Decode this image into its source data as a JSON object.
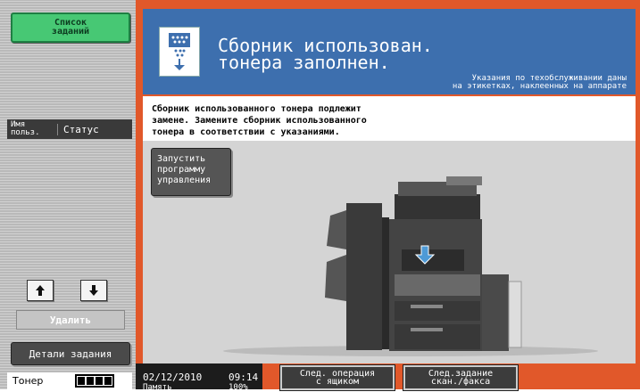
{
  "left_panel": {
    "job_list_button": "Список\nзаданий",
    "list_header": {
      "user": "Имя\nпольз.",
      "status": "Статус"
    },
    "delete_button": "Удалить",
    "details_button": "Детали задания",
    "toner": {
      "label": "Тонер",
      "level_fraction": 1.0
    }
  },
  "header": {
    "title": "Сборник использован.\nтонера заполнен.",
    "subtitle": "Указания по техобслуживании даны\nна этикетках, наклеенных на аппарате",
    "icon": "waste-toner-box-icon"
  },
  "message": "Сборник использованного тонера подлежит\nзамене. Замените сборник использованного\nтонера в соответствии с указаниями.",
  "launch_button": "Запустить\nпрограмму\nуправления",
  "bottom_bar": {
    "date": "02/12/2010",
    "time": "09:14",
    "memory_label": "Память",
    "memory_value": "100%",
    "next_operation_button": "След. операция\nс ящиком",
    "next_job_button": "След.задание\nскан./факса"
  },
  "colors": {
    "header_blue": "#3d6fae",
    "frame_orange": "#e1582a",
    "green_button": "#47c874"
  }
}
